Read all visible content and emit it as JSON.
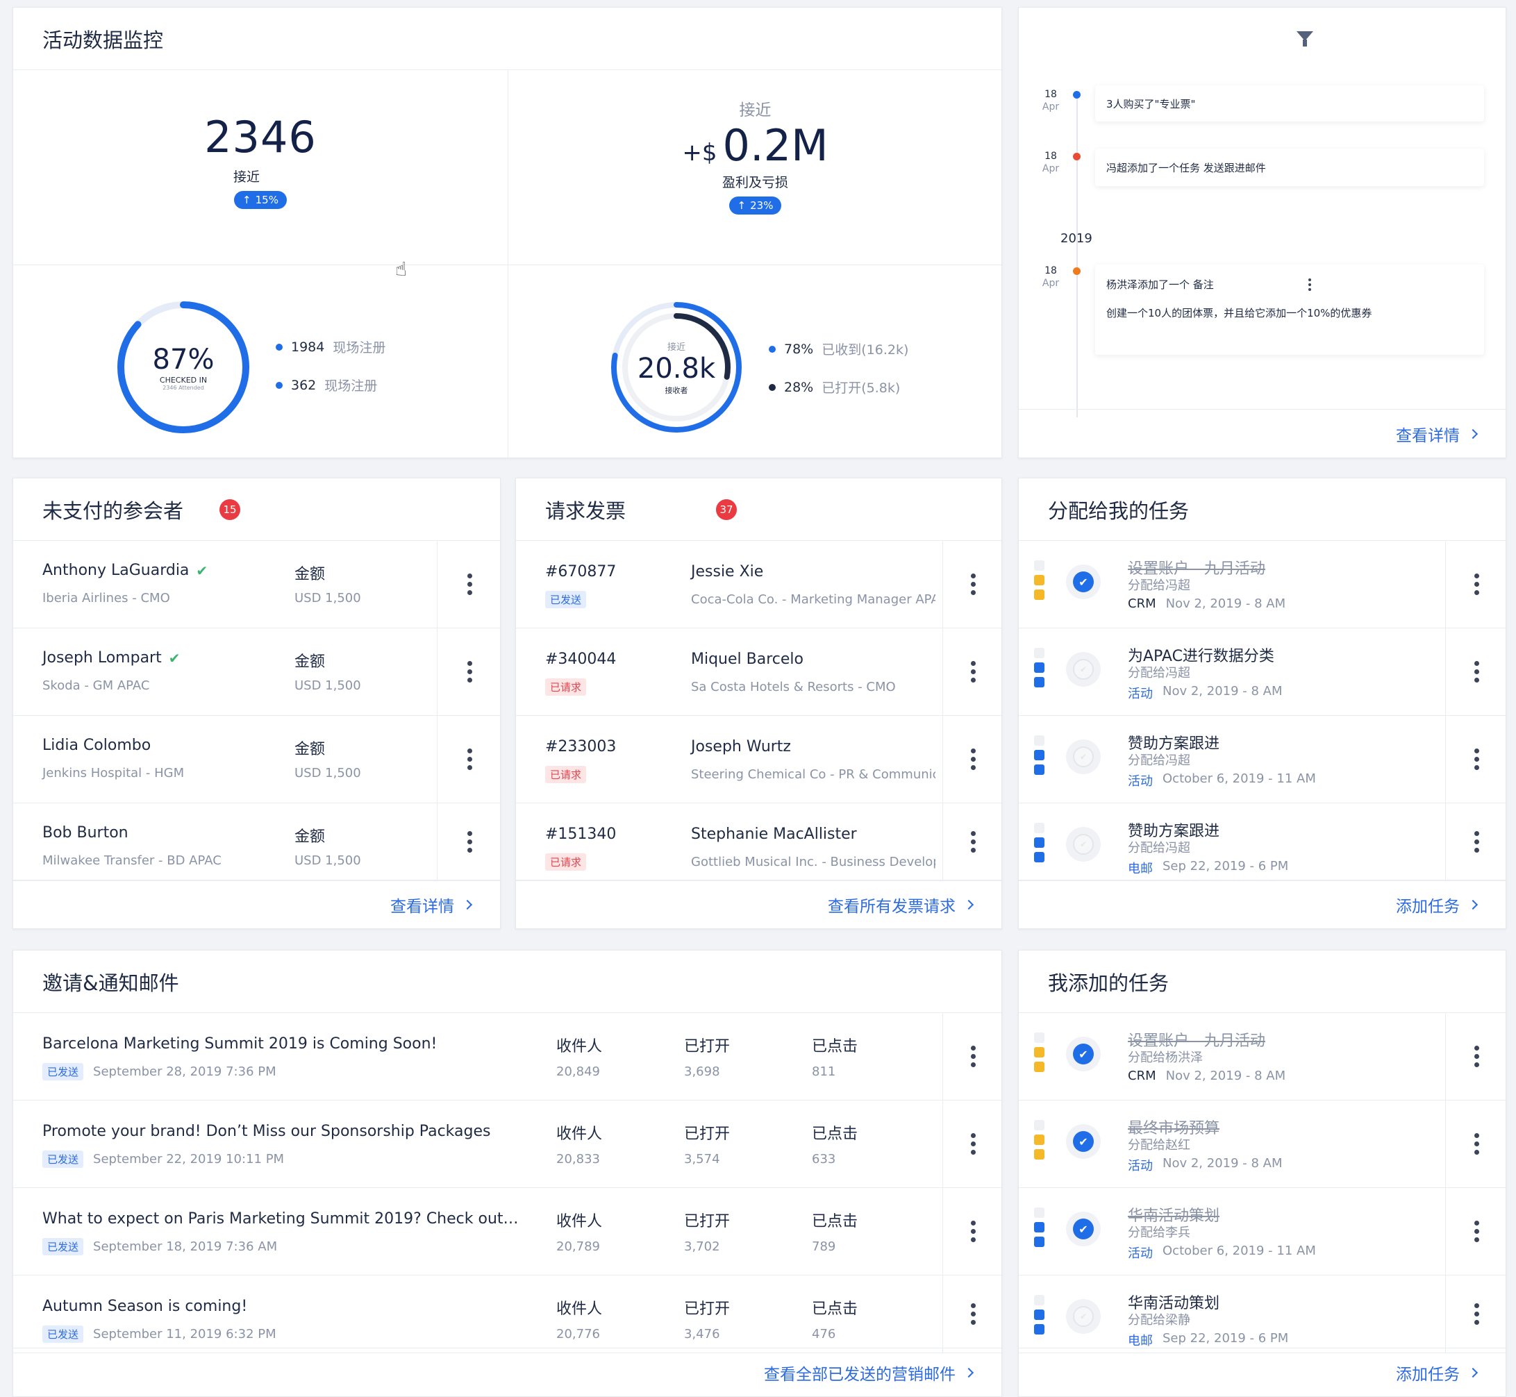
{
  "monitor": {
    "title": "活动数据监控",
    "stat1": {
      "value": "2346",
      "label": "接近",
      "change": "15%"
    },
    "stat2": {
      "top_label": "接近",
      "prefix": "+$",
      "value": "0.2M",
      "label": "盈利及亏损",
      "change": "23%"
    },
    "gauge1": {
      "percent": "87%",
      "sub1": "CHECKED IN",
      "sub2": "2346 Attended",
      "fill": 0.87,
      "legend": [
        {
          "num": "1984",
          "text": "现场注册",
          "color": "#1f6ee8"
        },
        {
          "num": "362",
          "text": "现场注册",
          "color": "#1f6ee8"
        }
      ]
    },
    "gauge2": {
      "top": "接近",
      "value": "20.8k",
      "sub": "接收者",
      "outer_fill": 0.78,
      "inner_fill": 0.28,
      "legend": [
        {
          "num": "78%",
          "text": "已收到(16.2k)",
          "color": "#1f6ee8"
        },
        {
          "num": "28%",
          "text": "已打开(5.8k)",
          "color": "#1f2a44"
        }
      ]
    }
  },
  "timeline": {
    "year": "2019",
    "items": [
      {
        "day": "18",
        "month": "Apr",
        "text": "3人购买了\"专业票\"",
        "color": "#1f6ee8"
      },
      {
        "day": "18",
        "month": "Apr",
        "text": "冯超添加了一个任务 发送跟进邮件",
        "color": "#ea4b35"
      },
      {
        "day": "18",
        "month": "Apr",
        "text": "杨洪泽添加了一个 备注",
        "note": "创建一个10人的团体票，并且给它添加一个10%的优惠券",
        "color": "#f07b1f"
      }
    ],
    "link": "查看详情"
  },
  "unpaid": {
    "title": "未支付的参会者",
    "count": "15",
    "rows": [
      {
        "name": "Anthony LaGuardia",
        "verified": true,
        "company": "Iberia Airlines - CMO",
        "amount_label": "金额",
        "amount": "USD 1,500"
      },
      {
        "name": "Joseph Lompart",
        "verified": true,
        "company": "Skoda - GM APAC",
        "amount_label": "金额",
        "amount": "USD 1,500"
      },
      {
        "name": "Lidia Colombo",
        "verified": false,
        "company": "Jenkins Hospital - HGM",
        "amount_label": "金额",
        "amount": "USD 1,500"
      },
      {
        "name": "Bob Burton",
        "verified": false,
        "company": "Milwakee Transfer - BD APAC",
        "amount_label": "金额",
        "amount": "USD 1,500"
      }
    ],
    "link": "查看详情"
  },
  "invoices": {
    "title": "请求发票",
    "count": "37",
    "rows": [
      {
        "id": "#670877",
        "status": "已发送",
        "kind": "sent",
        "name": "Jessie Xie",
        "company": "Coca-Cola Co. - Marketing Manager APAC"
      },
      {
        "id": "#340044",
        "status": "已请求",
        "kind": "req",
        "name": "Miquel Barcelo",
        "company": "Sa Costa Hotels & Resorts - CMO"
      },
      {
        "id": "#233003",
        "status": "已请求",
        "kind": "req",
        "name": "Joseph Wurtz",
        "company": "Steering Chemical Co - PR & Communicat"
      },
      {
        "id": "#151340",
        "status": "已请求",
        "kind": "req",
        "name": "Stephanie MacAllister",
        "company": "Gottlieb Musical Inc. - Business Developm"
      }
    ],
    "link": "查看所有发票请求"
  },
  "my_tasks": {
    "title": "分配给我的任务",
    "rows": [
      {
        "title": "设置账户 - 九月活动",
        "done": true,
        "assignee": "分配给冯超",
        "type": "CRM",
        "type_blue": false,
        "date": "Nov 2, 2019 - 8 AM",
        "prio": "#f4b829"
      },
      {
        "title": "为APAC进行数据分类",
        "done": false,
        "assignee": "分配给冯超",
        "type": "活动",
        "type_blue": true,
        "date": "Nov 2, 2019 - 8 AM",
        "prio": "#1f6ee8"
      },
      {
        "title": "赞助方案跟进",
        "done": false,
        "assignee": "分配给冯超",
        "type": "活动",
        "type_blue": true,
        "date": "October 6, 2019 - 11 AM",
        "prio": "#1f6ee8"
      },
      {
        "title": "赞助方案跟进",
        "done": false,
        "assignee": "分配给冯超",
        "type": "电邮",
        "type_blue": true,
        "date": "Sep 22, 2019 - 6 PM",
        "prio": "#1f6ee8"
      }
    ],
    "link": "添加任务"
  },
  "emails": {
    "title": "邀请&通知邮件",
    "col_recipients": "收件人",
    "col_opened": "已打开",
    "col_clicked": "已点击",
    "rows": [
      {
        "subject": "Barcelona Marketing Summit 2019 is Coming Soon!",
        "status": "已发送",
        "date": "September 28, 2019 7:36 PM",
        "recipients": "20,849",
        "opened": "3,698",
        "clicked": "811"
      },
      {
        "subject": "Promote your brand! Don’t Miss our Sponsorship Packages",
        "status": "已发送",
        "date": "September 22, 2019 10:11 PM",
        "recipients": "20,833",
        "opened": "3,574",
        "clicked": "633"
      },
      {
        "subject": "What to expect on Paris Marketing Summit 2019? Check out…",
        "status": "已发送",
        "date": "September 18, 2019 7:36 AM",
        "recipients": "20,789",
        "opened": "3,702",
        "clicked": "789"
      },
      {
        "subject": "Autumn Season is coming!",
        "status": "已发送",
        "date": "September 11, 2019 6:32 PM",
        "recipients": "20,776",
        "opened": "3,476",
        "clicked": "476"
      }
    ],
    "link": "查看全部已发送的营销邮件"
  },
  "added_tasks": {
    "title": "我添加的任务",
    "rows": [
      {
        "title": "设置账户 - 九月活动",
        "done": true,
        "assignee": "分配给杨洪泽",
        "type": "CRM",
        "type_blue": false,
        "date": "Nov 2, 2019 - 8 AM",
        "prio": "#f4b829"
      },
      {
        "title": "最终市场预算",
        "done": true,
        "assignee": "分配给赵红",
        "type": "活动",
        "type_blue": true,
        "date": "Nov 2, 2019 - 8 AM",
        "prio": "#f4b829"
      },
      {
        "title": "华南活动策划",
        "done": true,
        "assignee": "分配给李兵",
        "type": "活动",
        "type_blue": true,
        "date": "October 6, 2019 - 11 AM",
        "prio": "#1f6ee8"
      },
      {
        "title": "华南活动策划",
        "done": false,
        "assignee": "分配给梁静",
        "type": "电邮",
        "type_blue": true,
        "date": "Sep 22, 2019 - 6 PM",
        "prio": "#1f6ee8"
      }
    ],
    "link": "添加任务"
  }
}
